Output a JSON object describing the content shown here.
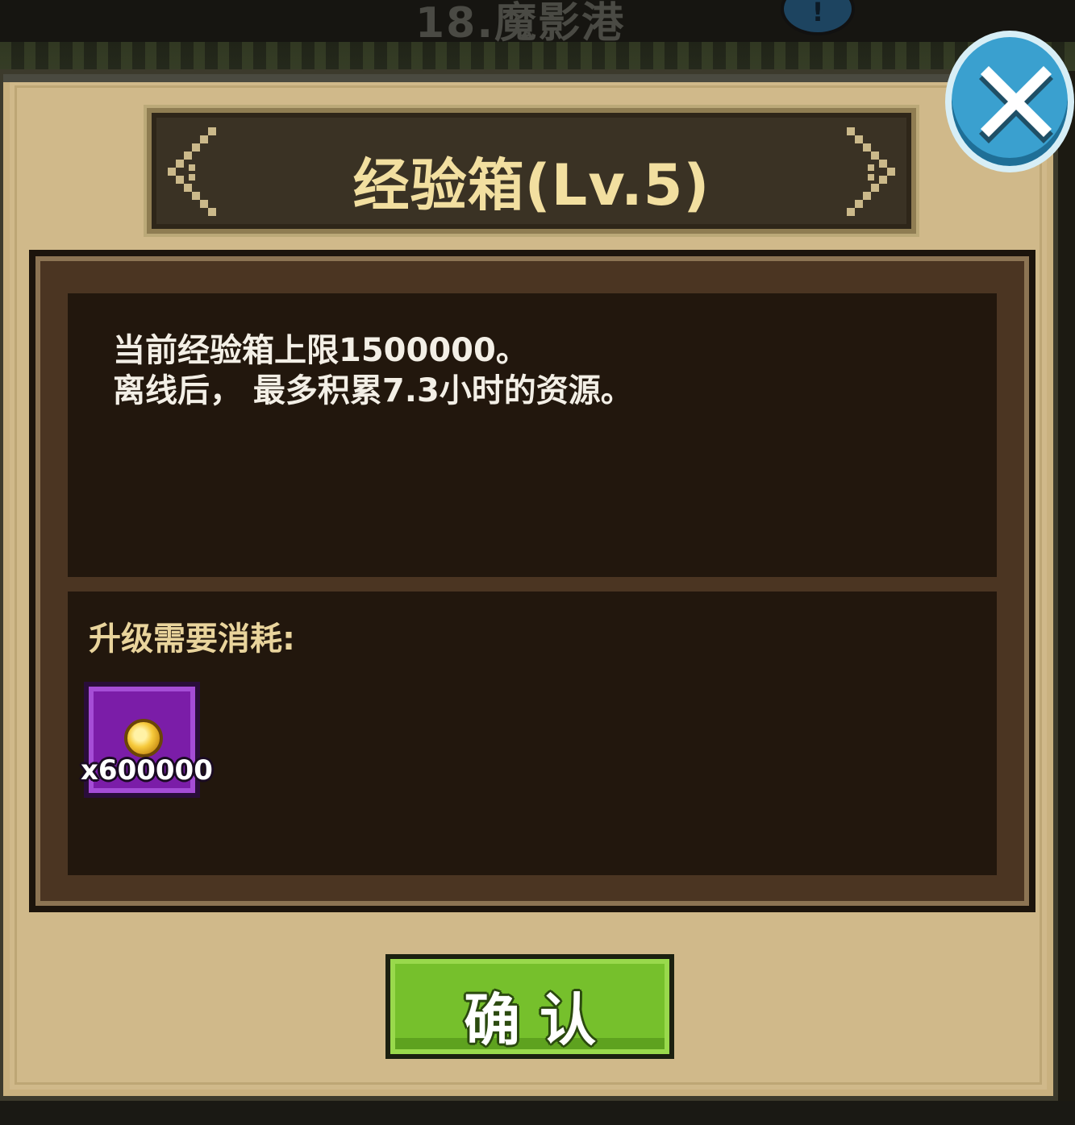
{
  "background": {
    "stage_title": "18.魔影港"
  },
  "dialog": {
    "title": "经验箱(Lv.5)",
    "info": {
      "line1": "当前经验箱上限1500000。",
      "line2": "离线后， 最多积累7.3小时的资源。"
    },
    "cost": {
      "label": "升级需要消耗:",
      "items": [
        {
          "icon": "gold-coin-icon",
          "amount": "x600000"
        }
      ]
    },
    "confirm_label": "确认",
    "close_icon": "close-icon"
  },
  "colors": {
    "panel_bg": "#d0b98a",
    "title_text": "#f2dfa0",
    "info_text": "#f3efe6",
    "confirm_green": "#76c02c",
    "close_blue": "#3aa0cf",
    "item_purple": "#7b1da8"
  }
}
